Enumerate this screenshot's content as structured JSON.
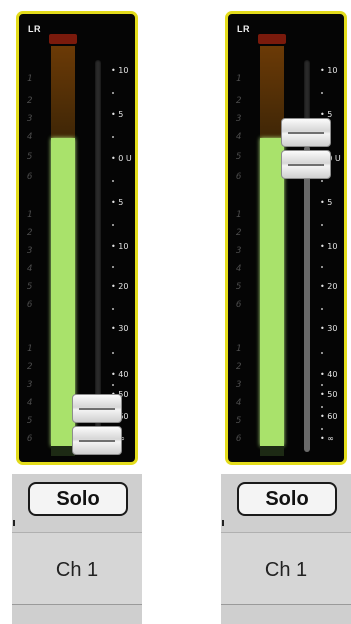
{
  "channels": [
    {
      "id": "left",
      "bus_label": "LR",
      "solo_label": "Solo",
      "name": "Ch 1",
      "fader_level_db": "-∞",
      "meter_level_fraction": 0.74,
      "left_scale": [
        "1",
        "2",
        "3",
        "4",
        "5",
        "6",
        "1",
        "2",
        "3",
        "4",
        "5",
        "6",
        "1",
        "2",
        "3",
        "4",
        "5",
        "6"
      ],
      "db_scale": [
        "10",
        "5",
        "0 U",
        "5",
        "10",
        "20",
        "30",
        "40",
        "50",
        "60",
        "∞"
      ]
    },
    {
      "id": "right",
      "bus_label": "LR",
      "solo_label": "Solo",
      "name": "Ch 1",
      "fader_level_db": "0",
      "meter_level_fraction": 0.74,
      "left_scale": [
        "1",
        "2",
        "3",
        "4",
        "5",
        "6",
        "1",
        "2",
        "3",
        "4",
        "5",
        "6",
        "1",
        "2",
        "3",
        "4",
        "5",
        "6"
      ],
      "db_scale": [
        "10",
        "5",
        "0 U",
        "5",
        "10",
        "20",
        "30",
        "40",
        "50",
        "60",
        "∞"
      ]
    }
  ],
  "colors": {
    "panel_border": "#e3dc1c",
    "meter_green": "#a9e26b",
    "meter_orange": "#6b3a06",
    "peak_red": "#7a1a0c"
  }
}
